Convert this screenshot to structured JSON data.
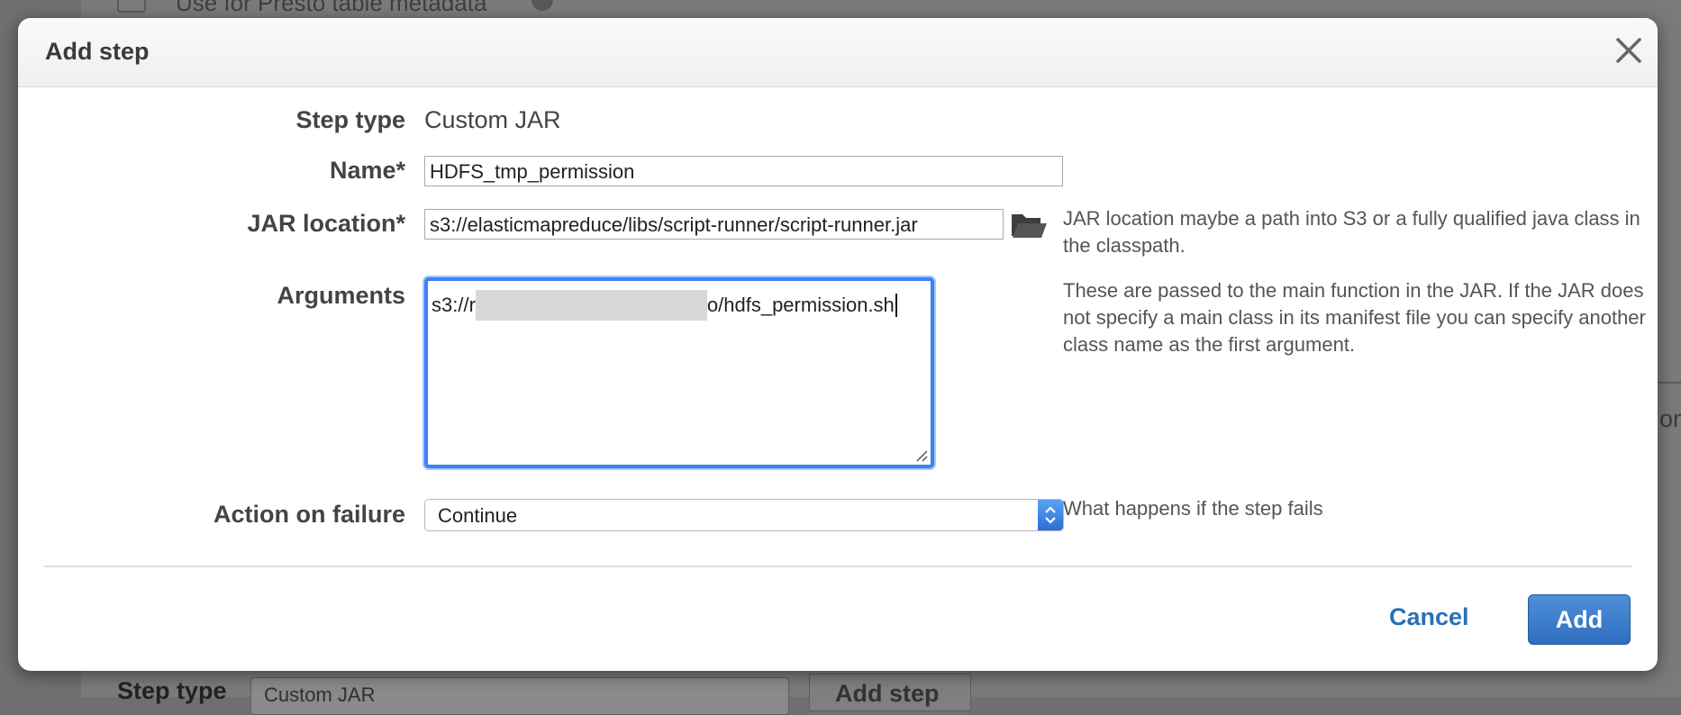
{
  "background": {
    "checkbox_label": "Use for Presto table metadata",
    "bottom_label": "Step type",
    "bottom_select": "Custom JAR",
    "bottom_button": "Add step",
    "right_text": "om"
  },
  "modal": {
    "title": "Add step",
    "step_type_label": "Step type",
    "step_type_value": "Custom JAR",
    "name_label": "Name*",
    "name_value": "HDFS_tmp_permission",
    "jar_label": "JAR location*",
    "jar_value": "s3://elasticmapreduce/libs/script-runner/script-runner.jar",
    "jar_help": "JAR location maybe a path into S3 or a fully qualified java class in the classpath.",
    "arguments_label": "Arguments",
    "arguments_prefix": "s3://r",
    "arguments_suffix": "o/hdfs_permission.sh",
    "arguments_help": "These are passed to the main function in the JAR. If the JAR does not specify a main class in its manifest file you can specify another class name as the first argument.",
    "action_label": "Action on failure",
    "action_value": "Continue",
    "action_help": "What happens if the step fails",
    "cancel_label": "Cancel",
    "add_label": "Add"
  },
  "colors": {
    "accent": "#2a6fb8",
    "focus_ring": "#3a82f6"
  },
  "icons": [
    "close-icon",
    "folder-open-icon",
    "select-arrows-icon",
    "resize-handle-icon",
    "info-icon"
  ]
}
